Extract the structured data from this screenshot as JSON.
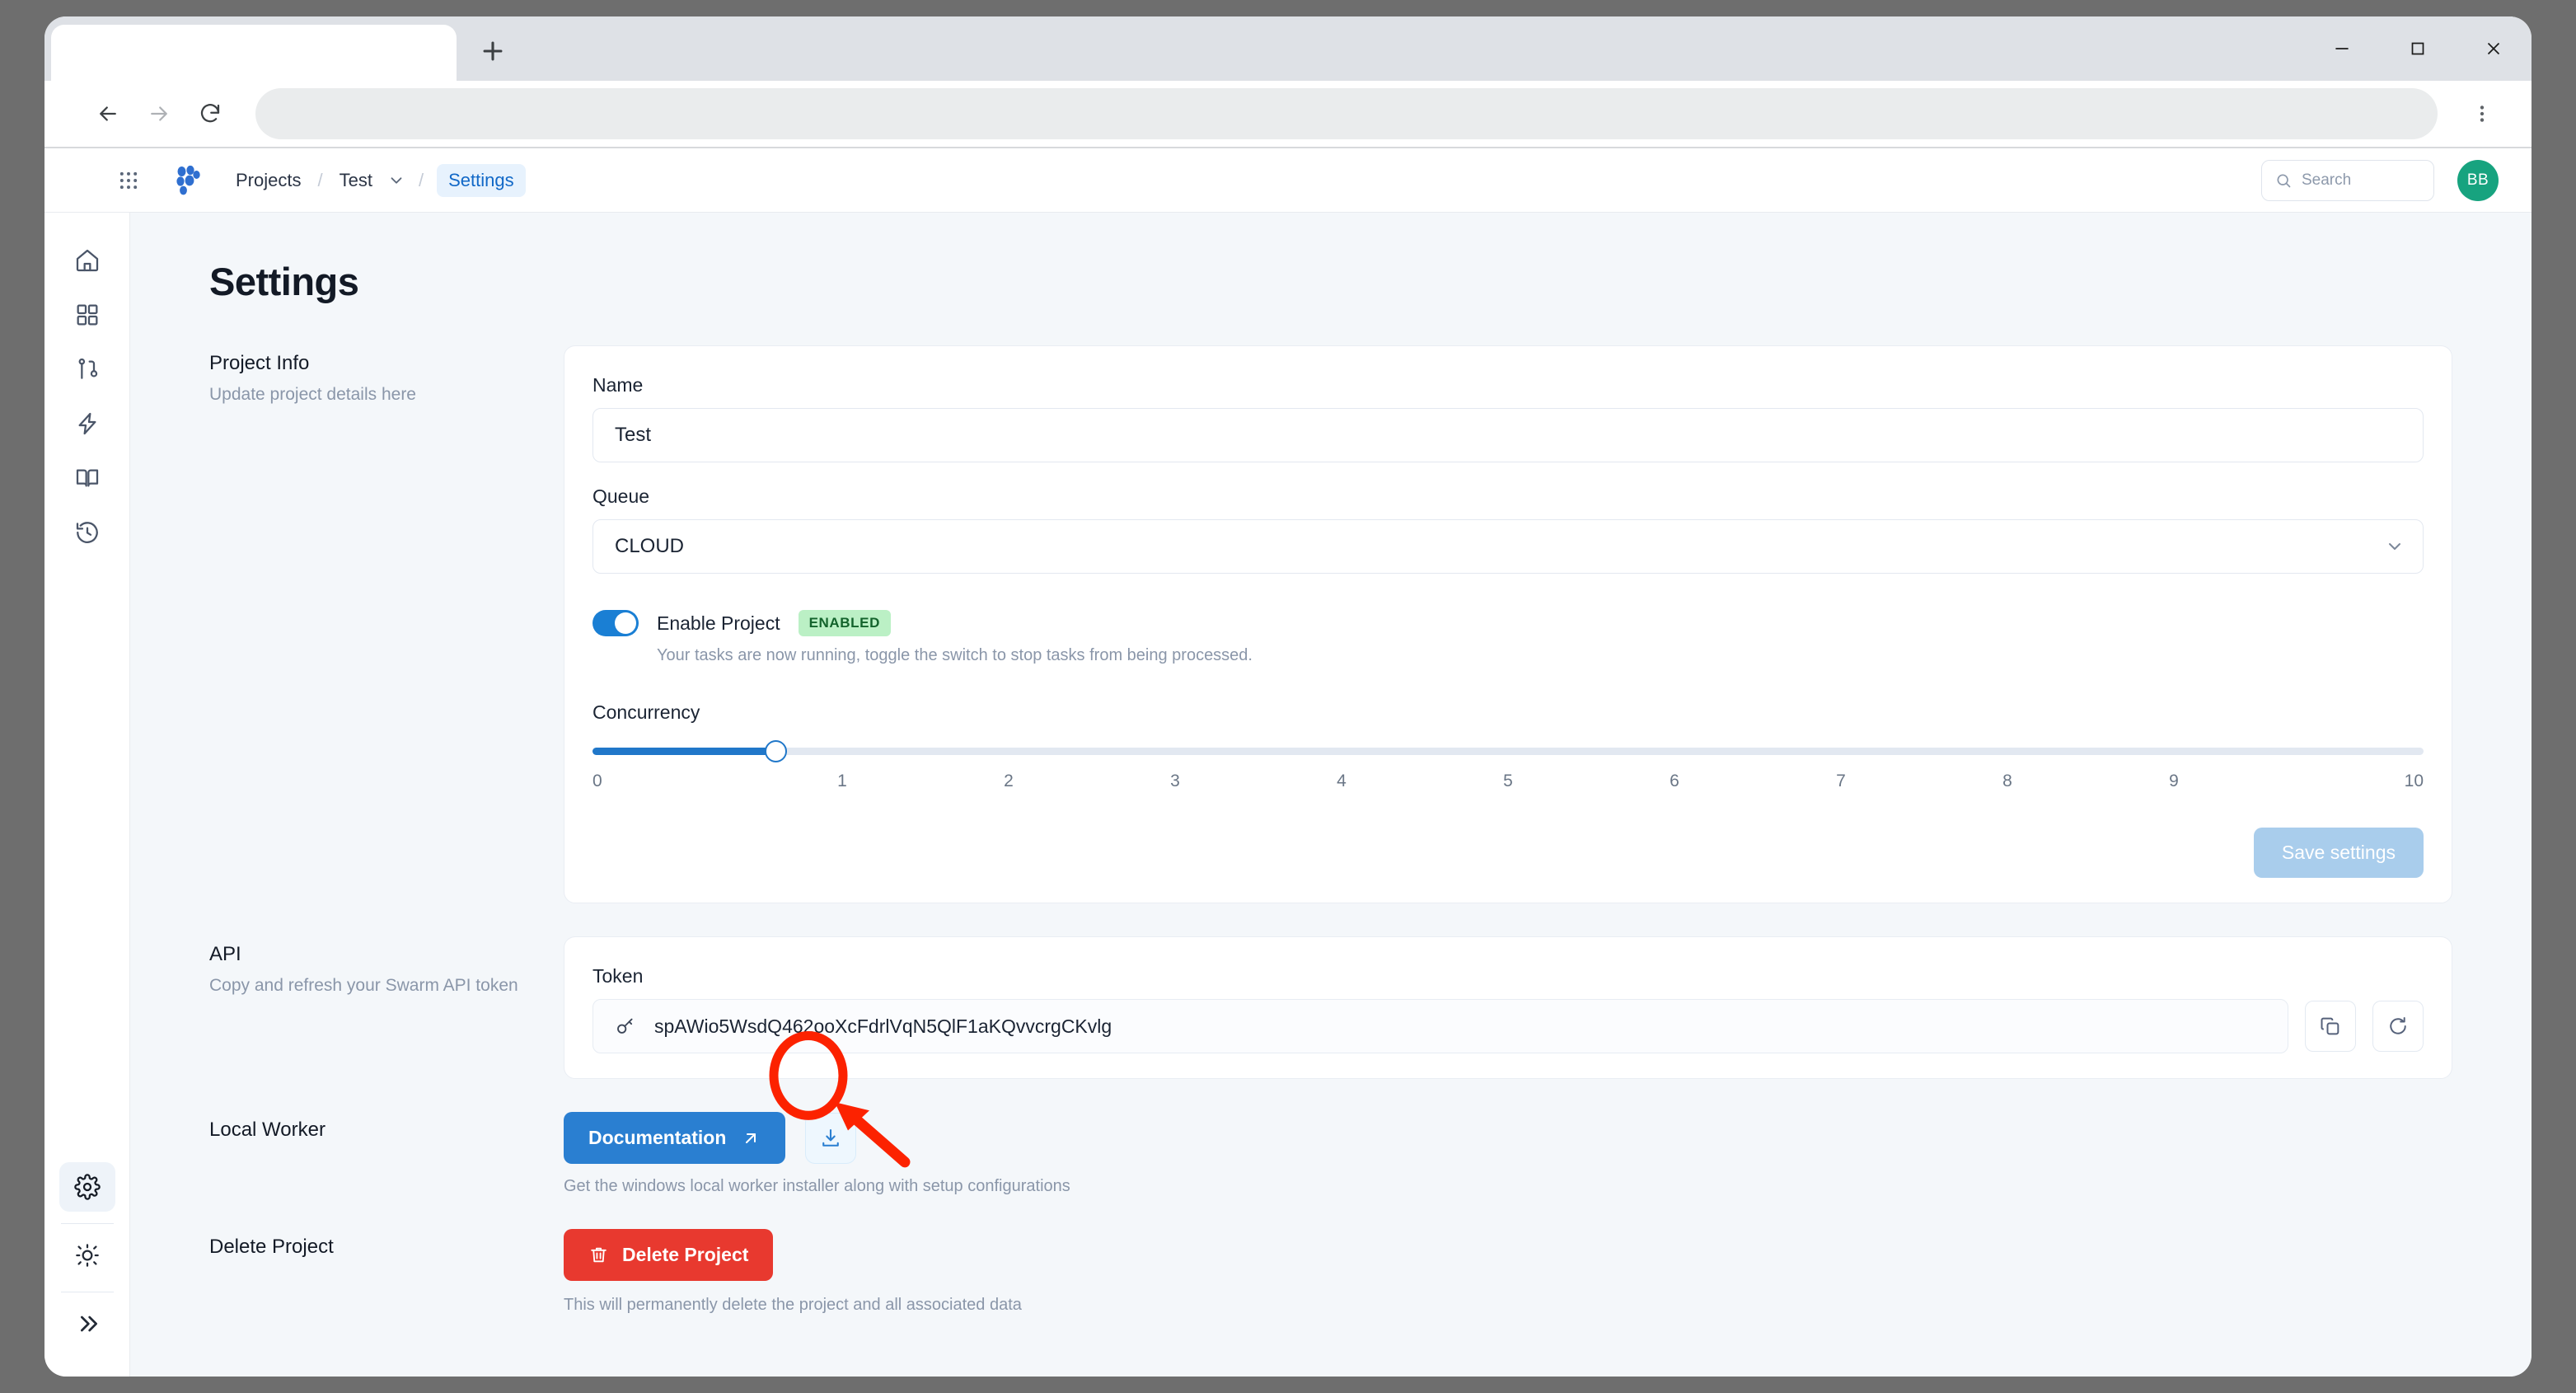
{
  "browser": {
    "tab_title": "",
    "new_tab_label": "+",
    "address_value": "",
    "minimize_icon": "minimize-icon",
    "maximize_icon": "maximize-icon",
    "close_icon": "close-icon",
    "back_icon": "back-arrow-icon",
    "forward_icon": "forward-arrow-icon",
    "reload_icon": "reload-icon",
    "menu_icon": "kebab-menu-icon"
  },
  "header": {
    "apps_icon": "apps-grid-icon",
    "logo_icon": "swarm-logo-icon",
    "breadcrumbs": [
      {
        "label": "Projects",
        "active": false
      },
      {
        "label": "Test",
        "active": false
      },
      {
        "label": "Settings",
        "active": true
      }
    ],
    "separator": "/",
    "project_chevron_icon": "chevron-down-icon",
    "search": {
      "placeholder": "Search",
      "icon": "search-icon",
      "value": ""
    },
    "avatar_initials": "BB",
    "avatar_color": "#17a37f"
  },
  "sidebar": {
    "items": [
      {
        "name": "home",
        "icon": "home-icon"
      },
      {
        "name": "dashboard",
        "icon": "grid-icon"
      },
      {
        "name": "pipelines",
        "icon": "git-branch-icon"
      },
      {
        "name": "automations",
        "icon": "zap-icon"
      },
      {
        "name": "docs",
        "icon": "book-icon"
      },
      {
        "name": "history",
        "icon": "history-icon"
      }
    ],
    "bottom_items": [
      {
        "name": "settings",
        "icon": "gear-icon",
        "active": true
      },
      {
        "name": "theme",
        "icon": "sun-icon",
        "active": false
      },
      {
        "name": "expand",
        "icon": "chevrons-right-icon",
        "active": false
      }
    ]
  },
  "page": {
    "title": "Settings",
    "sections": {
      "project_info": {
        "title": "Project Info",
        "subtitle": "Update project details here",
        "name_label": "Name",
        "name_value": "Test",
        "name_placeholder": "Name",
        "queue_label": "Queue",
        "queue_value": "CLOUD",
        "toggle_label": "Enable Project",
        "toggle_badge": "ENABLED",
        "toggle_enabled": true,
        "toggle_hint": "Your tasks are now running, toggle the switch to stop tasks from being processed.",
        "concurrency_label": "Concurrency",
        "concurrency_value": 1,
        "concurrency_min": 0,
        "concurrency_max": 10,
        "concurrency_ticks": [
          "0",
          "1",
          "2",
          "3",
          "4",
          "5",
          "6",
          "7",
          "8",
          "9",
          "10"
        ],
        "save_label": "Save settings",
        "save_disabled": true
      },
      "api": {
        "title": "API",
        "subtitle": "Copy and refresh your Swarm API token",
        "token_label": "Token",
        "token_value": "spAWio5WsdQ462ooXcFdrlVqN5QlF1aKQvvcrgCKvlg",
        "token_icon": "key-icon",
        "copy_icon": "copy-icon",
        "refresh_icon": "refresh-icon"
      },
      "local_worker": {
        "title": "Local Worker",
        "doc_label": "Documentation",
        "doc_icon": "external-link-icon",
        "download_icon": "download-icon",
        "hint": "Get the windows local worker installer along with setup configurations"
      },
      "delete_project": {
        "title": "Delete Project",
        "button_label": "Delete Project",
        "button_icon": "trash-icon",
        "hint": "This will permanently delete the project and all associated data"
      }
    }
  },
  "annotation": {
    "highlight_target": "download-installer-button",
    "color": "#fc2200",
    "shape": "ellipse-with-arrow"
  },
  "colors": {
    "accent_blue": "#2a7fd1",
    "danger_red": "#e8392f",
    "enabled_green": "#bbf0c5",
    "page_bg": "#f4f7fa"
  }
}
